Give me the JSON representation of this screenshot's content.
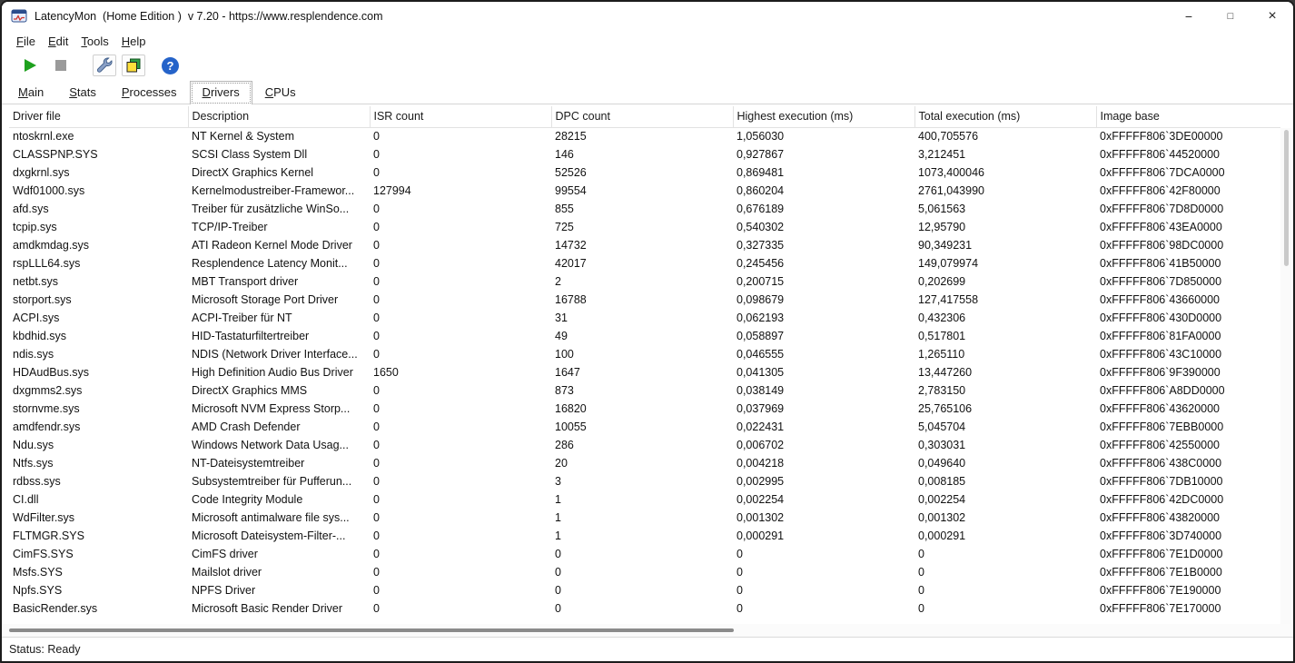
{
  "window": {
    "title": "LatencyMon  (Home Edition )  v 7.20 - https://www.resplendence.com",
    "controls": {
      "minimize": "−",
      "maximize": "□",
      "close": "×"
    }
  },
  "menu": {
    "items": [
      "File",
      "Edit",
      "Tools",
      "Help"
    ]
  },
  "toolbar": {
    "icons": {
      "play": "start-monitor-icon",
      "stop": "stop-monitor-icon",
      "wrench": "options-wrench-icon",
      "report": "report-pages-icon",
      "help_glyph": "?"
    }
  },
  "tabs": {
    "items": [
      "Main",
      "Stats",
      "Processes",
      "Drivers",
      "CPUs"
    ],
    "active": "Drivers"
  },
  "table": {
    "columns": [
      "Driver file",
      "Description",
      "ISR count",
      "DPC count",
      "Highest execution (ms)",
      "Total execution (ms)",
      "Image base"
    ],
    "rows": [
      [
        "ntoskrnl.exe",
        "NT Kernel & System",
        "0",
        "28215",
        "1,056030",
        "400,705576",
        "0xFFFFF806`3DE00000"
      ],
      [
        "CLASSPNP.SYS",
        "SCSI Class System Dll",
        "0",
        "146",
        "0,927867",
        "3,212451",
        "0xFFFFF806`44520000"
      ],
      [
        "dxgkrnl.sys",
        "DirectX Graphics Kernel",
        "0",
        "52526",
        "0,869481",
        "1073,400046",
        "0xFFFFF806`7DCA0000"
      ],
      [
        "Wdf01000.sys",
        "Kernelmodustreiber-Framewor...",
        "127994",
        "99554",
        "0,860204",
        "2761,043990",
        "0xFFFFF806`42F80000"
      ],
      [
        "afd.sys",
        "Treiber für zusätzliche WinSo...",
        "0",
        "855",
        "0,676189",
        "5,061563",
        "0xFFFFF806`7D8D0000"
      ],
      [
        "tcpip.sys",
        "TCP/IP-Treiber",
        "0",
        "725",
        "0,540302",
        "12,95790",
        "0xFFFFF806`43EA0000"
      ],
      [
        "amdkmdag.sys",
        "ATI Radeon Kernel Mode Driver",
        "0",
        "14732",
        "0,327335",
        "90,349231",
        "0xFFFFF806`98DC0000"
      ],
      [
        "rspLLL64.sys",
        "Resplendence Latency Monit...",
        "0",
        "42017",
        "0,245456",
        "149,079974",
        "0xFFFFF806`41B50000"
      ],
      [
        "netbt.sys",
        "MBT Transport driver",
        "0",
        "2",
        "0,200715",
        "0,202699",
        "0xFFFFF806`7D850000"
      ],
      [
        "storport.sys",
        "Microsoft Storage Port Driver",
        "0",
        "16788",
        "0,098679",
        "127,417558",
        "0xFFFFF806`43660000"
      ],
      [
        "ACPI.sys",
        "ACPI-Treiber für NT",
        "0",
        "31",
        "0,062193",
        "0,432306",
        "0xFFFFF806`430D0000"
      ],
      [
        "kbdhid.sys",
        "HID-Tastaturfiltertreiber",
        "0",
        "49",
        "0,058897",
        "0,517801",
        "0xFFFFF806`81FA0000"
      ],
      [
        "ndis.sys",
        "NDIS (Network Driver Interface...",
        "0",
        "100",
        "0,046555",
        "1,265110",
        "0xFFFFF806`43C10000"
      ],
      [
        "HDAudBus.sys",
        "High Definition Audio Bus Driver",
        "1650",
        "1647",
        "0,041305",
        "13,447260",
        "0xFFFFF806`9F390000"
      ],
      [
        "dxgmms2.sys",
        "DirectX Graphics MMS",
        "0",
        "873",
        "0,038149",
        "2,783150",
        "0xFFFFF806`A8DD0000"
      ],
      [
        "stornvme.sys",
        "Microsoft NVM Express Storp...",
        "0",
        "16820",
        "0,037969",
        "25,765106",
        "0xFFFFF806`43620000"
      ],
      [
        "amdfendr.sys",
        "AMD Crash Defender",
        "0",
        "10055",
        "0,022431",
        "5,045704",
        "0xFFFFF806`7EBB0000"
      ],
      [
        "Ndu.sys",
        "Windows Network Data Usag...",
        "0",
        "286",
        "0,006702",
        "0,303031",
        "0xFFFFF806`42550000"
      ],
      [
        "Ntfs.sys",
        "NT-Dateisystemtreiber",
        "0",
        "20",
        "0,004218",
        "0,049640",
        "0xFFFFF806`438C0000"
      ],
      [
        "rdbss.sys",
        "Subsystemtreiber für Pufferun...",
        "0",
        "3",
        "0,002995",
        "0,008185",
        "0xFFFFF806`7DB10000"
      ],
      [
        "CI.dll",
        "Code Integrity Module",
        "0",
        "1",
        "0,002254",
        "0,002254",
        "0xFFFFF806`42DC0000"
      ],
      [
        "WdFilter.sys",
        "Microsoft antimalware file sys...",
        "0",
        "1",
        "0,001302",
        "0,001302",
        "0xFFFFF806`43820000"
      ],
      [
        "FLTMGR.SYS",
        "Microsoft Dateisystem-Filter-...",
        "0",
        "1",
        "0,000291",
        "0,000291",
        "0xFFFFF806`3D740000"
      ],
      [
        "CimFS.SYS",
        "CimFS driver",
        "0",
        "0",
        "0",
        "0",
        "0xFFFFF806`7E1D0000"
      ],
      [
        "Msfs.SYS",
        "Mailslot driver",
        "0",
        "0",
        "0",
        "0",
        "0xFFFFF806`7E1B0000"
      ],
      [
        "Npfs.SYS",
        "NPFS Driver",
        "0",
        "0",
        "0",
        "0",
        "0xFFFFF806`7E190000"
      ],
      [
        "BasicRender.sys",
        "Microsoft Basic Render Driver",
        "0",
        "0",
        "0",
        "0",
        "0xFFFFF806`7E170000"
      ]
    ]
  },
  "status_bar": {
    "text": "Status: Ready"
  }
}
